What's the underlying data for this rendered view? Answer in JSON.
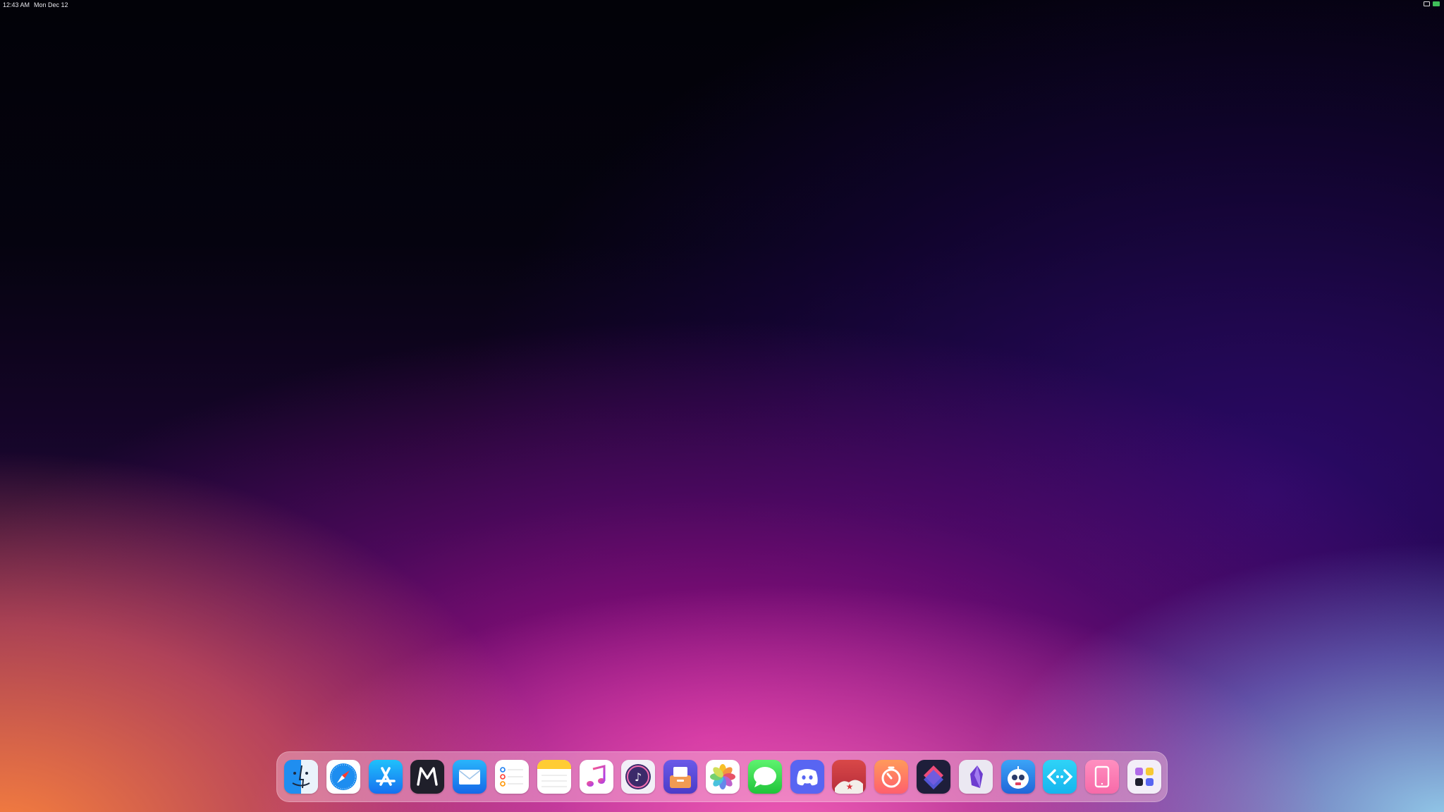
{
  "menubar": {
    "time": "12:43 AM",
    "date": "Mon Dec 12"
  },
  "dock": {
    "apps": [
      {
        "name": "Finder",
        "icon": "finder-icon"
      },
      {
        "name": "Safari",
        "icon": "safari-icon"
      },
      {
        "name": "App Store",
        "icon": "app-store-icon"
      },
      {
        "name": "Mona",
        "icon": "mona-icon"
      },
      {
        "name": "Mail",
        "icon": "mail-icon"
      },
      {
        "name": "Reminders",
        "icon": "reminders-icon"
      },
      {
        "name": "Notes",
        "icon": "notes-icon"
      },
      {
        "name": "Music",
        "icon": "music-icon"
      },
      {
        "name": "Music Player",
        "icon": "music-player-icon"
      },
      {
        "name": "Mail Client",
        "icon": "mail-drop-icon"
      },
      {
        "name": "Photos",
        "icon": "photos-icon"
      },
      {
        "name": "Messages",
        "icon": "messages-icon"
      },
      {
        "name": "Discord",
        "icon": "discord-icon"
      },
      {
        "name": "GoodLinks",
        "icon": "goodlinks-icon"
      },
      {
        "name": "Timer",
        "icon": "timer-icon"
      },
      {
        "name": "Shortcuts",
        "icon": "shortcuts-icon"
      },
      {
        "name": "Obsidian",
        "icon": "obsidian-icon"
      },
      {
        "name": "Tweetbot",
        "icon": "tweetbot-icon"
      },
      {
        "name": "Remote Desktop",
        "icon": "remote-desktop-icon"
      },
      {
        "name": "Sidecar",
        "icon": "tablet-icon"
      },
      {
        "name": "App Library",
        "icon": "app-library-icon"
      }
    ]
  }
}
